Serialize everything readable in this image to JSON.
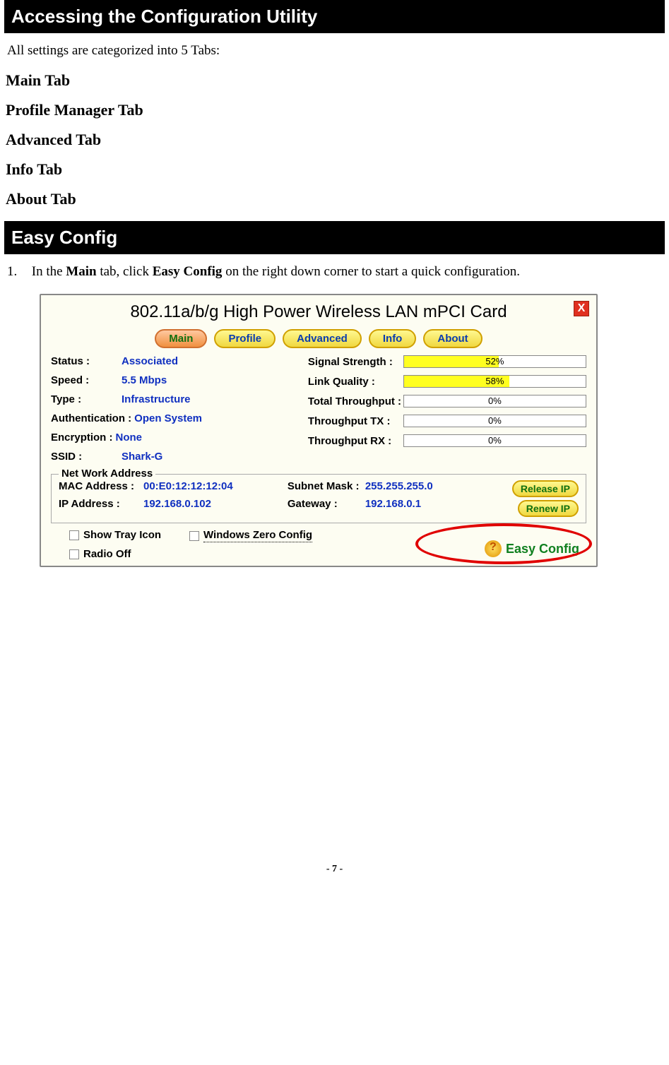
{
  "sections": {
    "accessing": "Accessing the Configuration Utility",
    "easy": "Easy Config"
  },
  "intro": "All settings are categorized into 5 Tabs:",
  "tabs_list": [
    "Main Tab",
    "Profile Manager Tab",
    "Advanced Tab",
    "Info Tab",
    "About Tab"
  ],
  "instruction": {
    "num": "1.",
    "pre": "In the ",
    "bold1": "Main",
    "mid": " tab, click ",
    "bold2": "Easy Config",
    "post": " on the right down corner to start a quick configuration."
  },
  "window": {
    "title": "802.11a/b/g High Power Wireless LAN mPCI Card",
    "close": "X",
    "nav": [
      "Main",
      "Profile",
      "Advanced",
      "Info",
      "About"
    ],
    "left": {
      "status_l": "Status :",
      "status_v": "Associated",
      "speed_l": "Speed :",
      "speed_v": "5.5 Mbps",
      "type_l": "Type :",
      "type_v": "Infrastructure",
      "auth_l": "Authentication :",
      "auth_v": "Open System",
      "enc_l": "Encryption :",
      "enc_v": "None",
      "ssid_l": "SSID :",
      "ssid_v": "Shark-G"
    },
    "right": {
      "sig_l": "Signal Strength :",
      "sig_v": "52%",
      "link_l": "Link Quality :",
      "link_v": "58%",
      "tot_l": "Total Throughput :",
      "tot_v": "0%",
      "tx_l": "Throughput TX :",
      "tx_v": "0%",
      "rx_l": "Throughput RX :",
      "rx_v": "0%"
    },
    "net": {
      "group": "Net Work Address",
      "mac_l": "MAC Address :",
      "mac_v": "00:E0:12:12:12:04",
      "ip_l": "IP Address :",
      "ip_v": "192.168.0.102",
      "mask_l": "Subnet Mask :",
      "mask_v": "255.255.255.0",
      "gw_l": "Gateway :",
      "gw_v": "192.168.0.1",
      "release": "Release IP",
      "renew": "Renew IP"
    },
    "checks": {
      "tray": "Show Tray Icon",
      "radio": "Radio Off",
      "wzc": "Windows Zero Config"
    },
    "easy_btn": "Easy Config"
  },
  "chart_data": {
    "type": "bar",
    "series": [
      {
        "name": "Signal Strength",
        "value": 52,
        "unit": "%"
      },
      {
        "name": "Link Quality",
        "value": 58,
        "unit": "%"
      },
      {
        "name": "Total Throughput",
        "value": 0,
        "unit": "%"
      },
      {
        "name": "Throughput TX",
        "value": 0,
        "unit": "%"
      },
      {
        "name": "Throughput RX",
        "value": 0,
        "unit": "%"
      }
    ],
    "range": [
      0,
      100
    ]
  },
  "footer": "- 7 -"
}
